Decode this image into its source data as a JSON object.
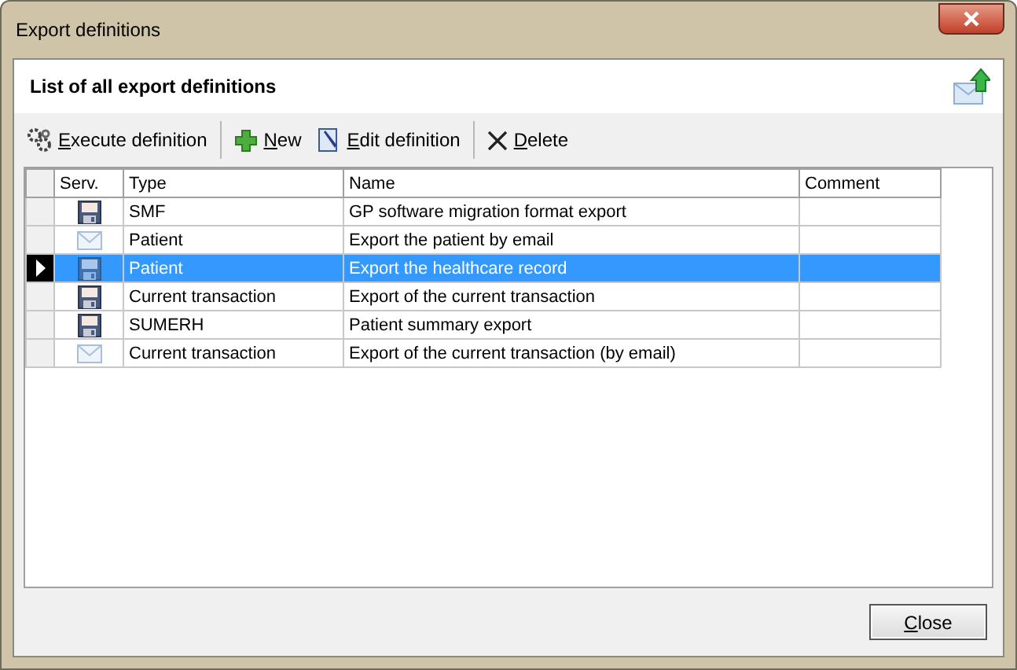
{
  "window": {
    "title": "Export definitions"
  },
  "header": {
    "title": "List of all export definitions"
  },
  "toolbar": [
    {
      "label": "Execute definition",
      "kind": "execute"
    },
    {
      "label": "New",
      "kind": "new"
    },
    {
      "label": "Edit definition",
      "kind": "edit"
    },
    {
      "label": "Delete",
      "kind": "delete"
    }
  ],
  "table": {
    "columns": [
      "Serv.",
      "Type",
      "Name",
      "Comment"
    ],
    "rows": [
      {
        "kind": "disk",
        "type": "SMF",
        "name": "GP software migration format export",
        "selected": false
      },
      {
        "kind": "mail",
        "type": "Patient",
        "name": "Export the patient by email",
        "selected": false
      },
      {
        "kind": "disk",
        "type": "Patient",
        "name": "Export the healthcare record",
        "selected": true
      },
      {
        "kind": "disk",
        "type": "Current transaction",
        "name": "Export of the current transaction",
        "selected": false
      },
      {
        "kind": "disk",
        "type": "SUMERH",
        "name": "Patient summary export",
        "selected": false
      },
      {
        "kind": "mail",
        "type": "Current transaction",
        "name": "Export of the current transaction (by email)",
        "selected": false
      }
    ]
  },
  "buttons": [
    {
      "label": "Close"
    }
  ]
}
